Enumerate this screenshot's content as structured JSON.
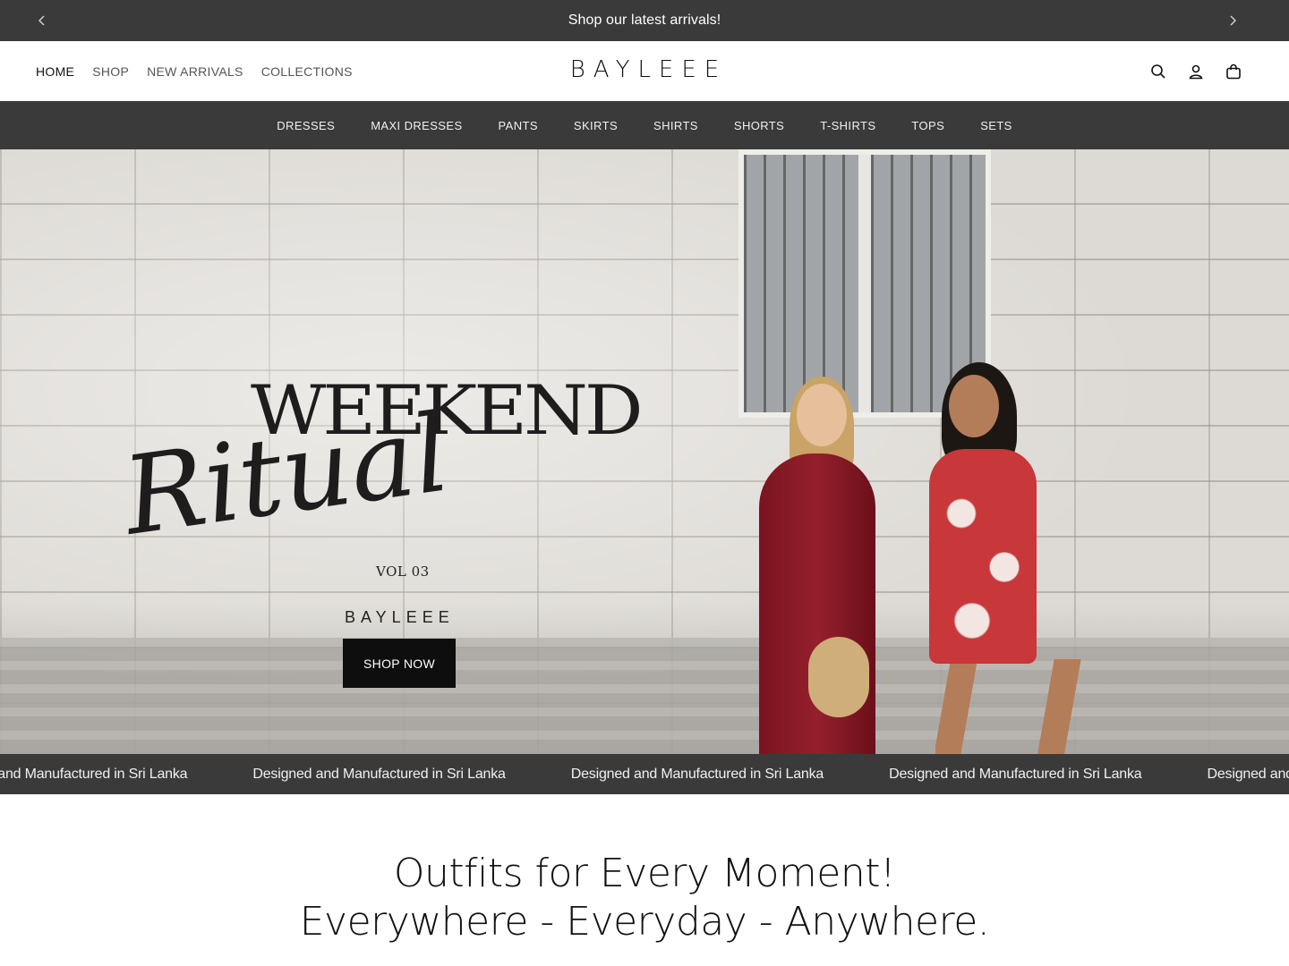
{
  "announcement": {
    "text": "Shop our latest arrivals!",
    "prev_icon": "chevron-left-icon",
    "next_icon": "chevron-right-icon"
  },
  "header": {
    "nav": [
      "HOME",
      "SHOP",
      "NEW ARRIVALS",
      "COLLECTIONS"
    ],
    "active_nav": "HOME",
    "logo": "BAYLEEE",
    "icons": [
      "search-icon",
      "account-icon",
      "cart-icon"
    ]
  },
  "categories": [
    "DRESSES",
    "MAXI DRESSES",
    "PANTS",
    "SKIRTS",
    "SHIRTS",
    "SHORTS",
    "T-SHIRTS",
    "TOPS",
    "SETS"
  ],
  "hero": {
    "title": "WEEKEND",
    "script": "Ritual",
    "volume": "VOL 03",
    "brand": "BAYLEEE",
    "cta": "SHOP NOW"
  },
  "marquee": {
    "text": "Designed and Manufactured in Sri Lanka"
  },
  "tagline": {
    "line1": "Outfits for Every Moment!",
    "line2": "Everywhere - Everyday - Anywhere."
  },
  "colors": {
    "dark_bar": "#3a3a3a",
    "cta": "#0e0e0e",
    "text": "#111111"
  }
}
